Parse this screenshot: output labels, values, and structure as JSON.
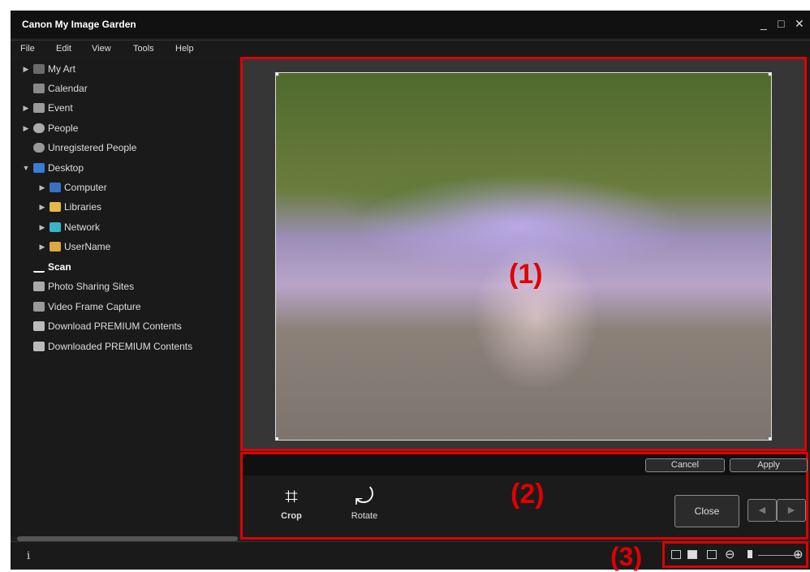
{
  "app": {
    "title": "Canon My Image Garden"
  },
  "window_controls": {
    "minimize": "_",
    "maximize": "□",
    "close": "✕"
  },
  "menu": [
    "File",
    "Edit",
    "View",
    "Tools",
    "Help"
  ],
  "tree": [
    {
      "label": "My Art",
      "expandable": true,
      "icon": "my-art-icon"
    },
    {
      "label": "Calendar",
      "expandable": false,
      "icon": "calendar-icon"
    },
    {
      "label": "Event",
      "expandable": true,
      "icon": "event-icon"
    },
    {
      "label": "People",
      "expandable": true,
      "icon": "people-icon"
    },
    {
      "label": "Unregistered People",
      "expandable": false,
      "icon": "unregistered-people-icon"
    },
    {
      "label": "Desktop",
      "expandable": true,
      "expanded": true,
      "icon": "desktop-icon"
    },
    {
      "label": "Computer",
      "expandable": true,
      "icon": "computer-icon"
    },
    {
      "label": "Libraries",
      "expandable": true,
      "icon": "libraries-icon"
    },
    {
      "label": "Network",
      "expandable": true,
      "icon": "network-icon"
    },
    {
      "label": "UserName",
      "expandable": true,
      "icon": "user-folder-icon"
    },
    {
      "label": "Scan",
      "selected": true,
      "icon": "scan-icon"
    },
    {
      "label": "Photo Sharing Sites",
      "icon": "photo-sharing-icon"
    },
    {
      "label": "Video Frame Capture",
      "icon": "video-frame-icon"
    },
    {
      "label": "Download PREMIUM Contents",
      "icon": "download-premium-icon"
    },
    {
      "label": "Downloaded PREMIUM Contents",
      "icon": "downloaded-premium-icon"
    }
  ],
  "viewer": {
    "callout": "(1)"
  },
  "edit": {
    "callout": "(2)",
    "cancel_label": "Cancel",
    "apply_label": "Apply",
    "crop_label": "Crop",
    "rotate_label": "Rotate",
    "close_label": "Close",
    "prev_icon": "◀",
    "next_icon": "▶"
  },
  "zoom": {
    "callout": "(3)",
    "minus_icon": "⊖",
    "plus_icon": "⊕"
  },
  "status": {
    "info_icon": "i"
  },
  "colors": {
    "accent": "#e00000",
    "background": "#1e1e1e"
  }
}
